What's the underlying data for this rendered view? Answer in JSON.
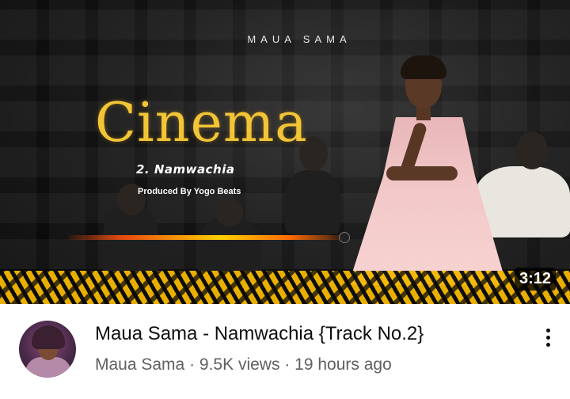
{
  "thumbnail": {
    "artist_tag": "MAUA SAMA",
    "title_art": "Cinema",
    "subtitle": "2. Namwachia",
    "producer": "Produced By Yogo Beats",
    "duration": "3:12"
  },
  "video": {
    "title": "Maua Sama - Namwachia {Track No.2}",
    "channel": "Maua Sama",
    "separator": "·",
    "views": "9.5K views",
    "age": "19 hours ago"
  },
  "colors": {
    "title_text": "#0f0f0f",
    "meta_text": "#606060",
    "accent_gold": "#f2c537"
  },
  "icons": {
    "more": "more-vert-icon"
  }
}
